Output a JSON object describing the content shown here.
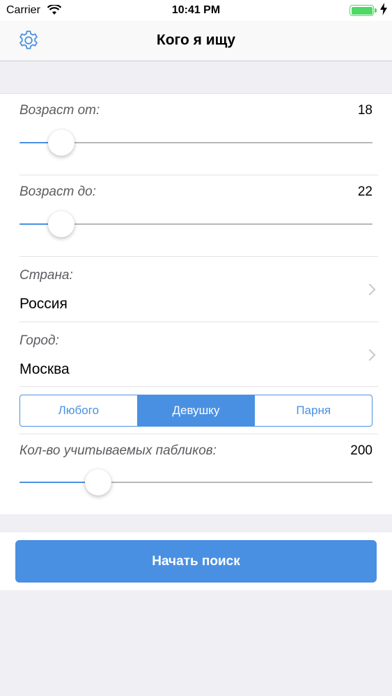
{
  "status_bar": {
    "carrier": "Carrier",
    "time": "10:41 PM",
    "battery_level": 1.0
  },
  "nav": {
    "title": "Кого я ищу",
    "settings_icon": "gear-icon"
  },
  "age_from": {
    "label": "Возраст от:",
    "value": "18",
    "slider_fraction": 0.117
  },
  "age_to": {
    "label": "Возраст до:",
    "value": "22",
    "slider_fraction": 0.117
  },
  "country": {
    "label": "Страна:",
    "value": "Россия"
  },
  "city": {
    "label": "Город:",
    "value": "Москва"
  },
  "gender": {
    "options": [
      "Любого",
      "Девушку",
      "Парня"
    ],
    "selected": "Девушку"
  },
  "publics": {
    "label": "Кол-во учитываемых пабликов:",
    "value": "200",
    "slider_fraction": 0.22
  },
  "actions": {
    "start_label": "Начать поиск"
  },
  "colors": {
    "accent": "#4a90e2",
    "background": "#efeff4",
    "battery": "#4cd964"
  }
}
